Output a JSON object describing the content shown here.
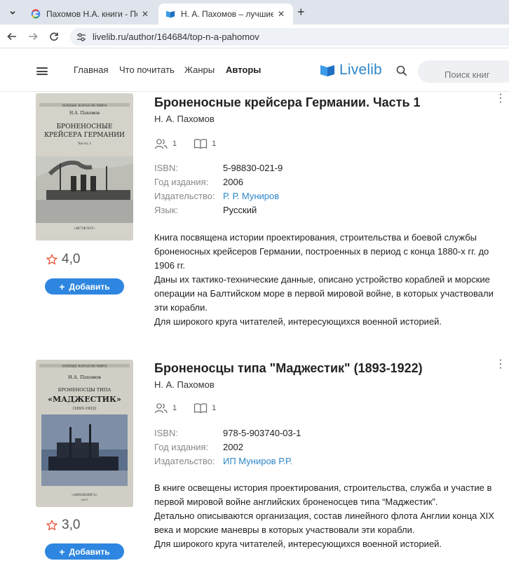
{
  "browser": {
    "tabs": [
      {
        "title": "Пахомов Н.А. книги - Поиск в",
        "favicon": "google-g-icon",
        "active": false
      },
      {
        "title": "Н. А. Пахомов – лучшие книги",
        "favicon": "livelib-book-icon",
        "active": true
      }
    ],
    "url": "livelib.ru/author/164684/top-n-a-pahomov"
  },
  "header": {
    "nav": [
      "Главная",
      "Что почитать",
      "Жанры",
      "Авторы"
    ],
    "logo_text": "Livelib",
    "search_placeholder": "Поиск книг"
  },
  "books": [
    {
      "title": "Броненосные крейсера Германии. Часть 1",
      "author": "Н. А. Пахомов",
      "readers": "1",
      "reviews": "1",
      "meta": [
        {
          "label": "ISBN:",
          "value": "5-98830-021-9"
        },
        {
          "label": "Год издания:",
          "value": "2006"
        },
        {
          "label": "Издательство:",
          "value": "Р. Р. Муниров"
        },
        {
          "label": "Язык:",
          "value": "Русский"
        }
      ],
      "description": [
        "Книга посвящена истории проектирования, строительства и боевой службы броненосных крейсеров Германии, построенных в период с конца 1880-х гг. до 1906 гг.",
        "Даны их тактико-технические данные, описано устройство кораблей и морские операции на Балтийском море в первой мировой войне, в которых участвовали эти корабли.",
        "Для широкого круга читателей, интересующихся военной историей."
      ],
      "rating": "4,0",
      "add_label": "Добавить",
      "cover": {
        "series": "БОЕВЫЕ КОРАБЛИ МИРА",
        "author": "Н.А. Пахомов",
        "title_line1": "БРОНЕНОСНЫЕ",
        "title_line2": "КРЕЙСЕРА ГЕРМАНИИ",
        "part": "Часть 1",
        "publisher": "«ИСТФЛОТ»"
      }
    },
    {
      "title": "Броненосцы типа \"Маджестик\" (1893-1922)",
      "author": "Н. А. Пахомов",
      "readers": "1",
      "reviews": "1",
      "meta": [
        {
          "label": "ISBN:",
          "value": "978-5-903740-03-1"
        },
        {
          "label": "Год издания:",
          "value": "2002"
        },
        {
          "label": "Издательство:",
          "value": "ИП Муниров Р.Р."
        }
      ],
      "description": [
        "В книге освещены история проектирования, строительства, служба и участие в первой мировой войне английских броненосцев типа “Маджестик”.",
        "Детально описываются организация, состав линейного флота Англии конца XIX века и морские маневры в которых участвовали эти корабли.",
        "Для широкого круга читателей, интересующихся военной историей."
      ],
      "rating": "3,0",
      "add_label": "Добавить",
      "cover": {
        "series": "БОЕВЫЕ КОРАБЛИ МИРА",
        "author": "Н.А. Пахомов",
        "title_line1": "БРОНЕНОСЦЫ ТИПА",
        "title_line2": "«МАДЖЕСТИК»",
        "part": "(1893-1922)",
        "publisher": "«АВИАКНИГА»",
        "year": "2007"
      }
    }
  ],
  "colors": {
    "accent": "#2e86e0",
    "link": "#2e86c9",
    "star": "#e5533a"
  }
}
